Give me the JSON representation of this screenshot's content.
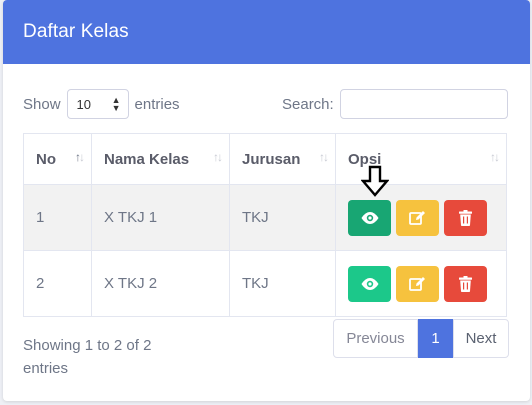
{
  "header": {
    "title": "Daftar Kelas"
  },
  "length": {
    "show_label": "Show",
    "value": "10",
    "entries_label": "entries"
  },
  "search": {
    "label": "Search:",
    "value": ""
  },
  "table": {
    "columns": [
      "No",
      "Nama Kelas",
      "Jurusan",
      "Opsi"
    ],
    "rows": [
      {
        "no": "1",
        "nama": "X TKJ 1",
        "jurusan": "TKJ"
      },
      {
        "no": "2",
        "nama": "X TKJ 2",
        "jurusan": "TKJ"
      }
    ]
  },
  "info": {
    "text": "Showing 1 to 2 of 2 entries"
  },
  "pagination": {
    "previous": "Previous",
    "current": "1",
    "next": "Next"
  },
  "colors": {
    "header": "#4e73df",
    "view": "#1cc88a",
    "edit": "#f6c23e",
    "delete": "#e74a3b"
  },
  "icons": {
    "view": "eye-icon",
    "edit": "edit-icon",
    "delete": "trash-icon",
    "pointer": "down-arrow-icon"
  }
}
